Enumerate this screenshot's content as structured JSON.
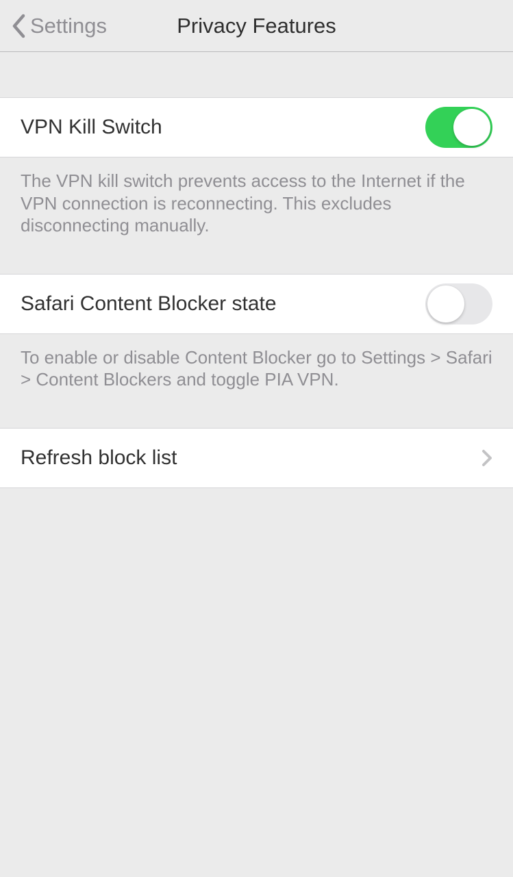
{
  "nav": {
    "back_label": "Settings",
    "title": "Privacy Features"
  },
  "sections": {
    "kill_switch": {
      "label": "VPN Kill Switch",
      "enabled": true,
      "footer": "The VPN kill switch prevents access to the Internet if the VPN connection is reconnecting. This excludes disconnecting manually."
    },
    "content_blocker": {
      "label": "Safari Content Blocker state",
      "enabled": false,
      "footer": "To enable or disable Content Blocker go to Settings > Safari > Content Blockers and toggle PIA VPN."
    },
    "refresh": {
      "label": "Refresh block list"
    }
  }
}
